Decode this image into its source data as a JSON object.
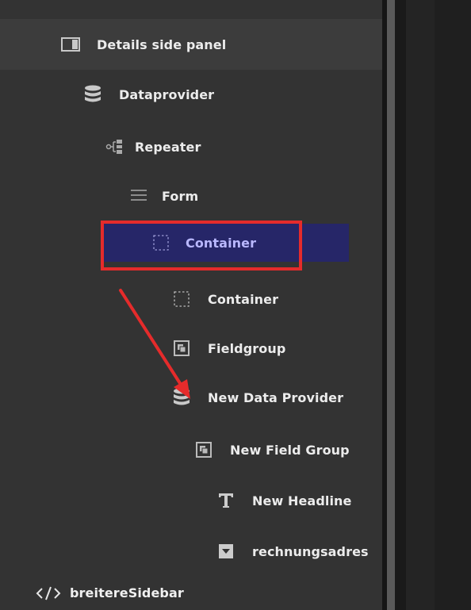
{
  "tree": {
    "items": [
      {
        "label": "Details side panel",
        "icon": "side-panel-icon"
      },
      {
        "label": "Dataprovider",
        "icon": "database-icon"
      },
      {
        "label": "Repeater",
        "icon": "repeater-icon"
      },
      {
        "label": "Form",
        "icon": "form-lines-icon"
      },
      {
        "label": "Container",
        "icon": "dashed-container-icon",
        "selected": true
      },
      {
        "label": "Container",
        "icon": "dashed-container-icon"
      },
      {
        "label": "Fieldgroup",
        "icon": "fieldgroup-icon"
      },
      {
        "label": "New Data Provider",
        "icon": "database-icon"
      },
      {
        "label": "New Field Group",
        "icon": "fieldgroup-icon"
      },
      {
        "label": "New Headline",
        "icon": "text-t-icon"
      },
      {
        "label": "rechnungsadres",
        "icon": "dropdown-icon"
      },
      {
        "label": "breitereSidebar",
        "icon": "code-tag-icon"
      }
    ]
  },
  "colors": {
    "panel_bg": "#333333",
    "header_bg": "#3c3c3c",
    "selected_bg": "#262668",
    "selected_text": "#b9b8ff",
    "highlight_red": "#e52b2b"
  }
}
